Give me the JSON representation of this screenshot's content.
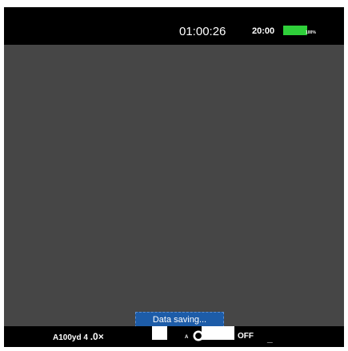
{
  "top_bar": {
    "timer": "01:00:26",
    "clock": "20:00",
    "battery_percent_text": "100%",
    "battery_level": 1.0,
    "battery_color": "#2fcf3a"
  },
  "viewfinder": {
    "background_color": "#464646"
  },
  "toast": {
    "message": "Data saving..."
  },
  "bottom_bar": {
    "distance": "A100yd",
    "number": "4",
    "zoom": ".0×",
    "mode_letter": "A",
    "mode_icon": "toggle-ring-icon",
    "status": "OFF",
    "dash": "_"
  }
}
